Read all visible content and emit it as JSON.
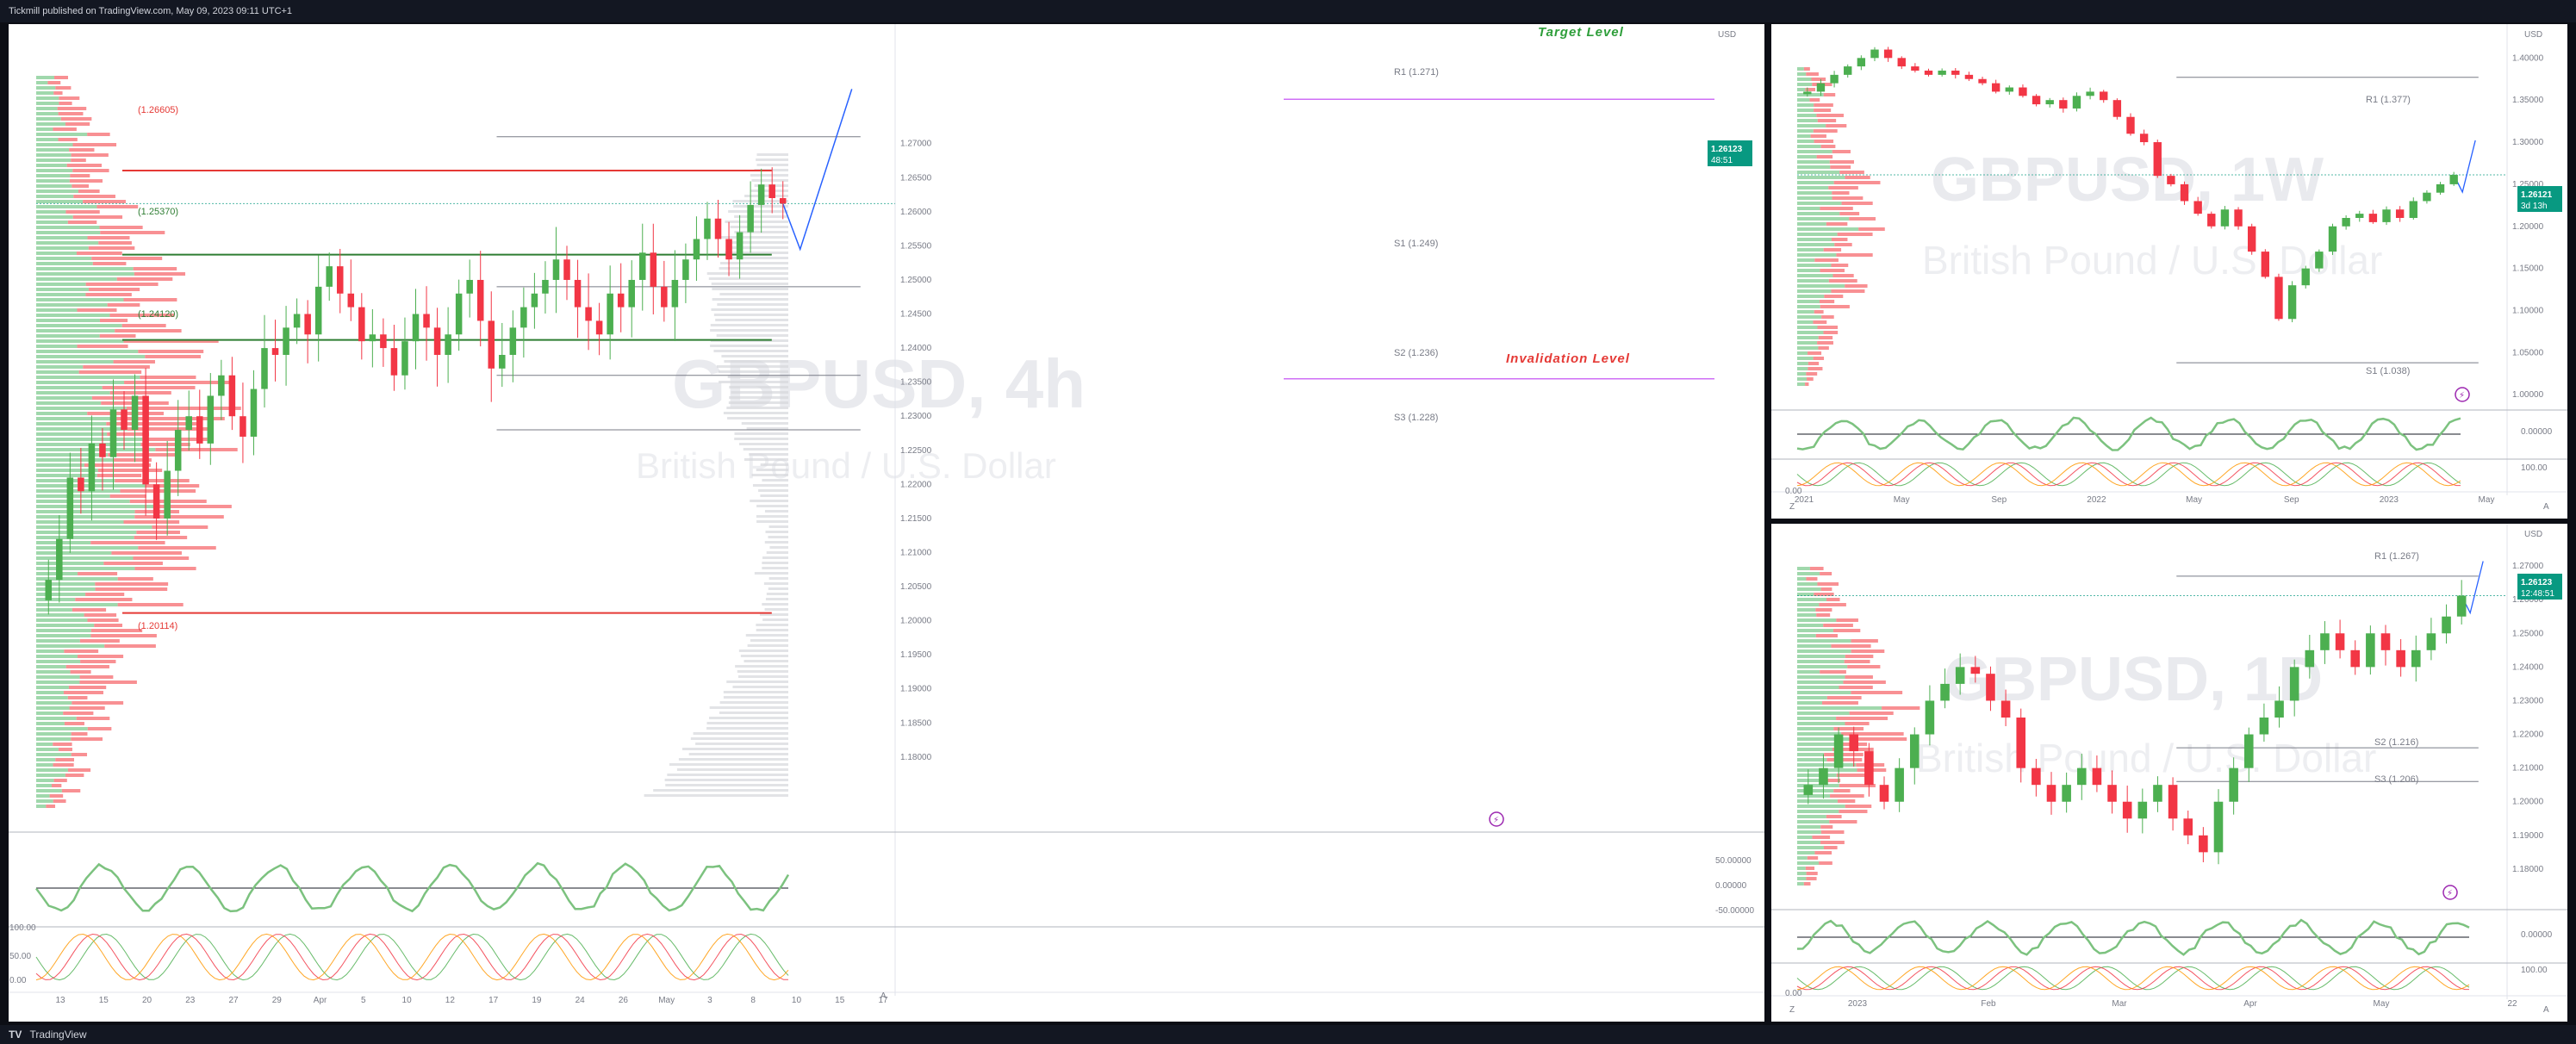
{
  "header": {
    "publisher_line": "Tickmill published on TradingView.com, May 09, 2023 09:11 UTC+1"
  },
  "footer": {
    "brand": "TradingView",
    "logo_icon": "tradingview-logo-icon"
  },
  "colors": {
    "bull": "#4caf50",
    "bear": "#f23645",
    "support_line": "#2e7d32",
    "resistance_line": "#e53935",
    "level_grey": "#787b86",
    "target_line": "#cf6ff6",
    "projection": "#2962ff",
    "price_label": "#089981"
  },
  "chart_data": [
    {
      "type": "candlestick",
      "panel": "main",
      "watermark_symbol": "GBPUSD, 4h",
      "watermark_name": "British Pound / U.S. Dollar",
      "currency": "USD",
      "ylim": [
        1.17,
        1.285
      ],
      "y_ticks": [
        "1.27000",
        "1.26500",
        "1.26000",
        "1.25500",
        "1.25000",
        "1.24500",
        "1.24000",
        "1.23500",
        "1.23000",
        "1.22500",
        "1.22000",
        "1.21500",
        "1.21000",
        "1.20500",
        "1.20000",
        "1.19500",
        "1.19000",
        "1.18500",
        "1.18000"
      ],
      "x_ticks": [
        "13",
        "15",
        "20",
        "23",
        "27",
        "29",
        "Apr",
        "5",
        "10",
        "12",
        "17",
        "19",
        "24",
        "26",
        "May",
        "3",
        "8",
        "10",
        "15",
        "17"
      ],
      "last_price": "1.26123",
      "countdown": "48:51",
      "pivot_levels": [
        {
          "label": "R1 (1.271)",
          "value": 1.271
        },
        {
          "label": "S1 (1.249)",
          "value": 1.249
        },
        {
          "label": "S2 (1.236)",
          "value": 1.236
        },
        {
          "label": "S3 (1.228)",
          "value": 1.228
        }
      ],
      "key_levels": [
        {
          "label": "(1.26605)",
          "value": 1.26605,
          "color": "red"
        },
        {
          "label": "(1.25370)",
          "value": 1.2537,
          "color": "green"
        },
        {
          "label": "(1.24120)",
          "value": 1.2412,
          "color": "green"
        },
        {
          "label": "(1.20114)",
          "value": 1.20114,
          "color": "red"
        }
      ],
      "annotations": [
        {
          "text": "Target  Level",
          "value": 1.2765,
          "color": "green"
        },
        {
          "text": "Invalidation Level",
          "value": 1.2355,
          "color": "red"
        }
      ],
      "closes": [
        1.206,
        1.212,
        1.221,
        1.219,
        1.226,
        1.224,
        1.231,
        1.228,
        1.233,
        1.22,
        1.215,
        1.222,
        1.228,
        1.23,
        1.226,
        1.233,
        1.236,
        1.23,
        1.227,
        1.234,
        1.24,
        1.239,
        1.243,
        1.245,
        1.242,
        1.249,
        1.252,
        1.248,
        1.246,
        1.241,
        1.242,
        1.24,
        1.236,
        1.241,
        1.245,
        1.243,
        1.239,
        1.242,
        1.248,
        1.25,
        1.244,
        1.237,
        1.239,
        1.243,
        1.246,
        1.248,
        1.25,
        1.253,
        1.25,
        1.246,
        1.244,
        1.242,
        1.248,
        1.246,
        1.25,
        1.254,
        1.249,
        1.246,
        1.25,
        1.253,
        1.256,
        1.259,
        1.256,
        1.253,
        1.257,
        1.261,
        1.264,
        1.262,
        1.2612
      ],
      "oscillator_ticks": [
        "50.00000",
        "0.00000",
        "-50.00000"
      ],
      "stoch_ticks": [
        "100.00",
        "50.00",
        "0.00"
      ]
    },
    {
      "type": "candlestick",
      "panel": "weekly",
      "watermark_symbol": "GBPUSD, 1W",
      "watermark_name": "British Pound / U.S. Dollar",
      "currency": "USD",
      "ylim": [
        0.99,
        1.43
      ],
      "y_ticks": [
        "1.40000",
        "1.35000",
        "1.30000",
        "1.25000",
        "1.20000",
        "1.15000",
        "1.10000",
        "1.05000",
        "1.00000"
      ],
      "x_ticks": [
        "2021",
        "May",
        "Sep",
        "2022",
        "May",
        "Sep",
        "2023",
        "May"
      ],
      "last_price": "1.26121",
      "countdown": "3d 13h",
      "pivot_levels": [
        {
          "label": "R1 (1.377)",
          "value": 1.377
        },
        {
          "label": "S1 (1.038)",
          "value": 1.038
        }
      ],
      "closes": [
        1.36,
        1.37,
        1.38,
        1.39,
        1.4,
        1.41,
        1.4,
        1.39,
        1.385,
        1.38,
        1.385,
        1.38,
        1.375,
        1.37,
        1.36,
        1.365,
        1.355,
        1.345,
        1.35,
        1.34,
        1.355,
        1.36,
        1.35,
        1.33,
        1.31,
        1.3,
        1.26,
        1.25,
        1.23,
        1.215,
        1.2,
        1.22,
        1.2,
        1.17,
        1.14,
        1.09,
        1.13,
        1.15,
        1.17,
        1.2,
        1.21,
        1.215,
        1.205,
        1.22,
        1.21,
        1.23,
        1.24,
        1.25,
        1.2612
      ],
      "oscillator_ticks": [
        "0.00000"
      ],
      "stoch_ticks": [
        "100.00",
        "0.00"
      ]
    },
    {
      "type": "candlestick",
      "panel": "daily",
      "watermark_symbol": "GBPUSD, 1D",
      "watermark_name": "British Pound / U.S. Dollar",
      "currency": "USD",
      "ylim": [
        1.17,
        1.28
      ],
      "y_ticks": [
        "1.27000",
        "1.26000",
        "1.25000",
        "1.24000",
        "1.23000",
        "1.22000",
        "1.21000",
        "1.20000",
        "1.19000",
        "1.18000"
      ],
      "x_ticks": [
        "2023",
        "Feb",
        "Mar",
        "Apr",
        "May",
        "22"
      ],
      "last_price": "1.26123",
      "countdown": "12:48:51",
      "pivot_levels": [
        {
          "label": "R1 (1.267)",
          "value": 1.267
        },
        {
          "label": "S2 (1.216)",
          "value": 1.216
        },
        {
          "label": "S3 (1.206)",
          "value": 1.206
        }
      ],
      "closes": [
        1.205,
        1.21,
        1.22,
        1.215,
        1.205,
        1.2,
        1.21,
        1.22,
        1.23,
        1.235,
        1.24,
        1.238,
        1.23,
        1.225,
        1.21,
        1.205,
        1.2,
        1.205,
        1.21,
        1.205,
        1.2,
        1.195,
        1.2,
        1.205,
        1.195,
        1.19,
        1.185,
        1.2,
        1.21,
        1.22,
        1.225,
        1.23,
        1.24,
        1.245,
        1.25,
        1.245,
        1.24,
        1.25,
        1.245,
        1.24,
        1.245,
        1.25,
        1.255,
        1.2612
      ],
      "oscillator_ticks": [
        "0.00000"
      ],
      "stoch_ticks": [
        "100.00",
        "0.00"
      ]
    }
  ]
}
